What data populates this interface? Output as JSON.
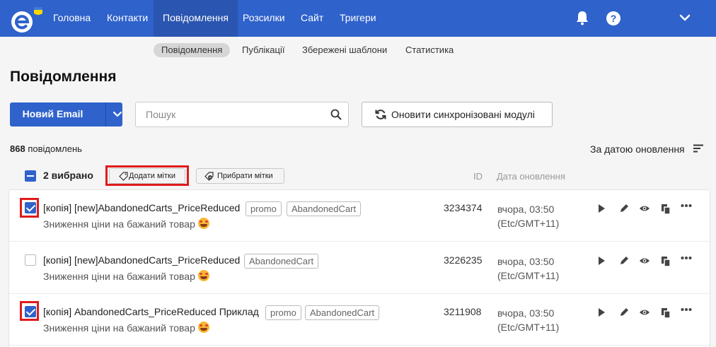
{
  "nav": {
    "items": [
      "Головна",
      "Контакти",
      "Повідомлення",
      "Розсилки",
      "Сайт",
      "Тригери"
    ],
    "active_index": 2
  },
  "subnav": {
    "items": [
      "Повідомлення",
      "Публікації",
      "Збережені шаблони",
      "Статистика"
    ],
    "active_index": 0
  },
  "page_title": "Повідомлення",
  "toolbar": {
    "new_email_label": "Новий Email",
    "search_placeholder": "Пошук",
    "sync_label": "Оновити синхронізовані модулі"
  },
  "summary": {
    "count": "868",
    "count_suffix": "повідомлень",
    "sort_label": "За датою оновлення"
  },
  "selection": {
    "selected_text": "2 вибрано",
    "add_tags_label": "Додати мітки",
    "remove_tags_label": "Прибрати мітки",
    "col_id": "ID",
    "col_date": "Дата оновлення"
  },
  "rows": [
    {
      "checked": true,
      "title": "[копія] [new]AbandonedCarts_PriceReduced",
      "tags": [
        "promo",
        "AbandonedCart"
      ],
      "subtitle": "Зниження ціни на бажаний товар",
      "id": "3234374",
      "date_line1": "вчора, 03:50",
      "date_line2": "(Etc/GMT+11)"
    },
    {
      "checked": false,
      "title": "[копія] [new]AbandonedCarts_PriceReduced",
      "tags": [
        "AbandonedCart"
      ],
      "subtitle": "Зниження ціни на бажаний товар",
      "id": "3226235",
      "date_line1": "вчора, 03:50",
      "date_line2": "(Etc/GMT+11)"
    },
    {
      "checked": true,
      "title": "[копія] AbandonedCarts_PriceReduced Приклад",
      "tags": [
        "promo",
        "AbandonedCart"
      ],
      "subtitle": "Зниження ціни на бажаний товар",
      "id": "3211908",
      "date_line1": "вчора, 03:50",
      "date_line2": "(Etc/GMT+11)"
    }
  ],
  "colors": {
    "brand": "#2f62cb",
    "highlight": "#e01b1b"
  }
}
